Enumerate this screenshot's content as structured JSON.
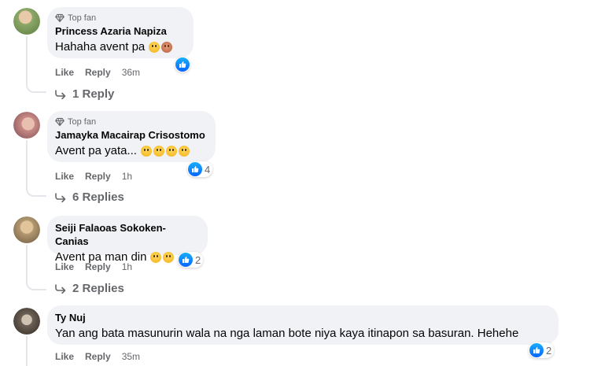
{
  "comments": [
    {
      "badge": "Top fan",
      "author": "Princess Azaria Napiza",
      "text": "Hahaha avent pa",
      "emojis": [
        "laughing-face",
        "woman-facepalming"
      ],
      "reaction_count": "",
      "actions": {
        "like": "Like",
        "reply": "Reply",
        "time": "36m"
      },
      "replies": "1 Reply",
      "avatar_color": "#8da86a"
    },
    {
      "badge": "Top fan",
      "author": "Jamayka Macairap Crisostomo",
      "text": "Avent pa yata...",
      "emojis": [
        "grimacing-face",
        "grinning-face",
        "laughing-face",
        "grinning-face"
      ],
      "reaction_count": "4",
      "actions": {
        "like": "Like",
        "reply": "Reply",
        "time": "1h"
      },
      "replies": "6 Replies",
      "avatar_color": "#c98a86"
    },
    {
      "badge": "",
      "author": "Seiji Falaoas Sokoken-Canias",
      "text": "Avent pa man din",
      "emojis": [
        "grinning-face",
        "grinning-squinting-face"
      ],
      "reaction_count": "2",
      "actions": {
        "like": "Like",
        "reply": "Reply",
        "time": "1h"
      },
      "replies": "2 Replies",
      "avatar_color": "#b49a72"
    },
    {
      "badge": "",
      "author": "Ty Nuj",
      "text": "Yan ang bata masunurin wala na nga laman bote niya kaya itinapon sa basuran. Hehehe",
      "emojis": [],
      "reaction_count": "2",
      "actions": {
        "like": "Like",
        "reply": "Reply",
        "time": "35m"
      },
      "replies": "",
      "avatar_color": "#6e6256"
    }
  ],
  "colors": {
    "bubble": "#f0f2f5",
    "secondary_text": "#65676b",
    "like_blue": "#0866ff"
  }
}
